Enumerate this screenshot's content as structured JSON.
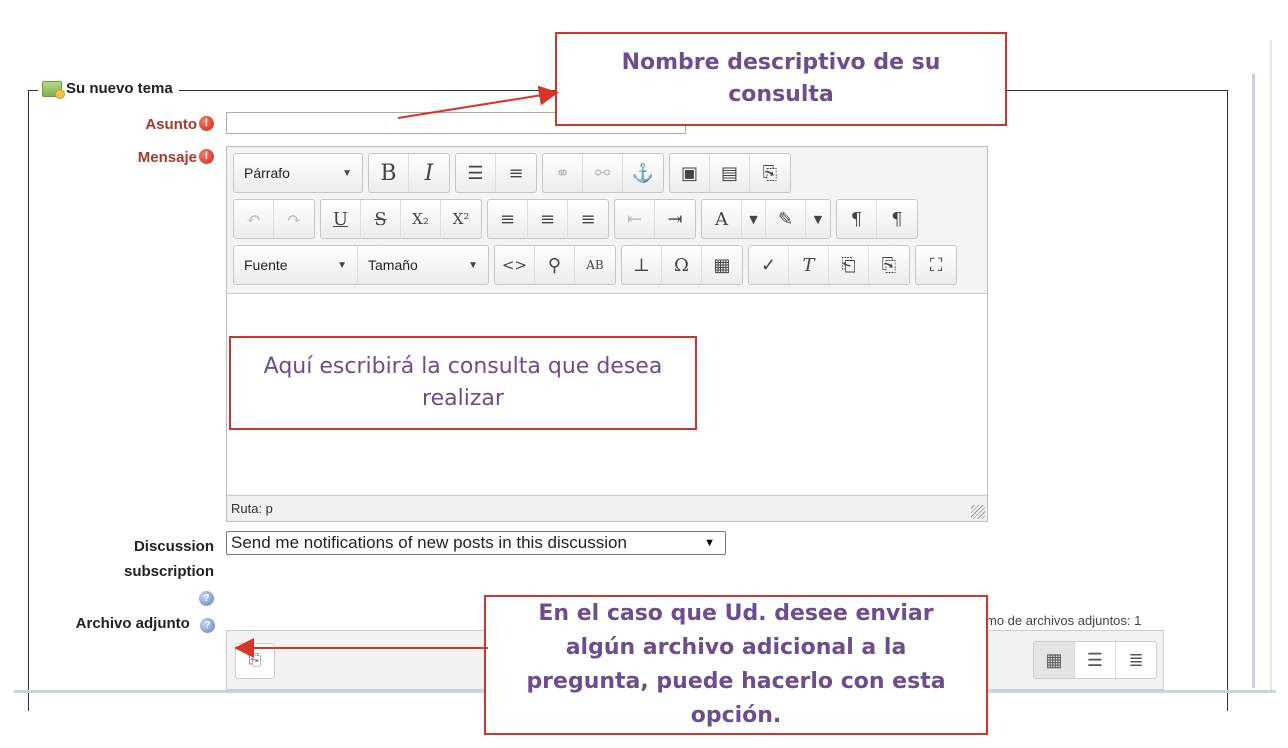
{
  "form": {
    "legend": "Su nuevo tema",
    "asunto_label": "Asunto",
    "mensaje_label": "Mensaje",
    "required_symbol": "!",
    "subscription_label_1": "Discussion",
    "subscription_label_2": "subscription",
    "subscription_value": "Send me notifications of new posts in this discussion",
    "attachment_label": "Archivo adjunto",
    "max_attachments": "mo de archivos adjuntos: 1",
    "help_symbol": "?"
  },
  "editor": {
    "format_combo": "Párrafo",
    "font_combo": "Fuente",
    "size_combo": "Tamaño",
    "path": "Ruta: p"
  },
  "callouts": {
    "subject": "Nombre descriptivo de su consulta",
    "message": "Aquí escribirá la consulta que desea realizar",
    "attachment": "En el caso que Ud. desee enviar algún archivo adicional a la pregunta, puede hacerlo con esta opción."
  },
  "colors": {
    "required": "#a33a2b",
    "callout_border": "#c8372d",
    "callout_text": "#6b4e8b"
  }
}
